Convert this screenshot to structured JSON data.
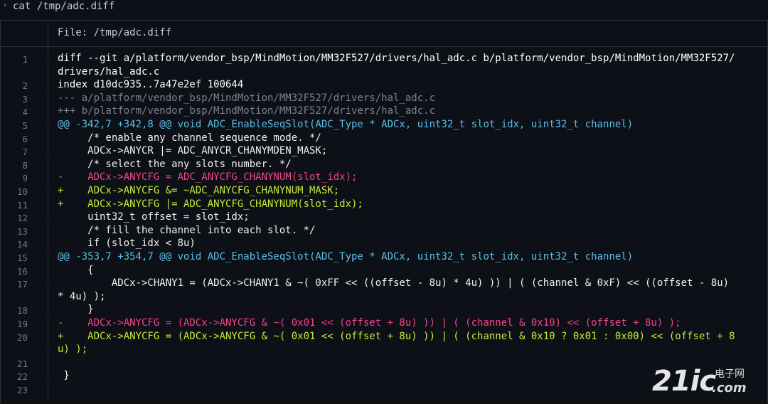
{
  "command": {
    "caret": "›",
    "text": "cat /tmp/adc.diff"
  },
  "file_header": {
    "title": "File: /tmp/adc.diff"
  },
  "lines": [
    {
      "n": "1",
      "text": "diff --git a/platform/vendor_bsp/MindMotion/MM32F527/drivers/hal_adc.c b/platform/vendor_bsp/MindMotion/MM32F527/",
      "kind": "meta"
    },
    {
      "n": "",
      "text": "drivers/hal_adc.c",
      "kind": "meta"
    },
    {
      "n": "2",
      "text": "index d10dc935..7a47e2ef 100644",
      "kind": "meta"
    },
    {
      "n": "3",
      "text": "--- a/platform/vendor_bsp/MindMotion/MM32F527/drivers/hal_adc.c",
      "kind": "hdrminus"
    },
    {
      "n": "4",
      "text": "+++ b/platform/vendor_bsp/MindMotion/MM32F527/drivers/hal_adc.c",
      "kind": "hdrplus"
    },
    {
      "n": "5",
      "text": "@@ -342,7 +342,8 @@ void ADC_EnableSeqSlot(ADC_Type * ADCx, uint32_t slot_idx, uint32_t channel)",
      "kind": "hunk"
    },
    {
      "n": "6",
      "text": "     /* enable any channel sequence mode. */",
      "kind": "ctx"
    },
    {
      "n": "7",
      "text": "     ADCx->ANYCR |= ADC_ANYCR_CHANYMDEN_MASK;",
      "kind": "ctx"
    },
    {
      "n": "8",
      "text": "     /* select the any slots number. */",
      "kind": "ctx"
    },
    {
      "n": "9",
      "text": "-    ADCx->ANYCFG = ADC_ANYCFG_CHANYNUM(slot_idx);",
      "kind": "del"
    },
    {
      "n": "10",
      "text": "+    ADCx->ANYCFG &= ~ADC_ANYCFG_CHANYNUM_MASK;",
      "kind": "add"
    },
    {
      "n": "11",
      "text": "+    ADCx->ANYCFG |= ADC_ANYCFG_CHANYNUM(slot_idx);",
      "kind": "add"
    },
    {
      "n": "12",
      "text": "     uint32_t offset = slot_idx;",
      "kind": "ctx"
    },
    {
      "n": "13",
      "text": "     /* fill the channel into each slot. */",
      "kind": "ctx"
    },
    {
      "n": "14",
      "text": "     if (slot_idx < 8u)",
      "kind": "ctx"
    },
    {
      "n": "15",
      "text": "@@ -353,7 +354,7 @@ void ADC_EnableSeqSlot(ADC_Type * ADCx, uint32_t slot_idx, uint32_t channel)",
      "kind": "hunk"
    },
    {
      "n": "16",
      "text": "     {",
      "kind": "ctx"
    },
    {
      "n": "17",
      "text": "         ADCx->CHANY1 = (ADCx->CHANY1 & ~( 0xFF << ((offset - 8u) * 4u) )) | ( (channel & 0xF) << ((offset - 8u)",
      "kind": "ctx"
    },
    {
      "n": "",
      "text": "* 4u) );",
      "kind": "ctx"
    },
    {
      "n": "18",
      "text": "     }",
      "kind": "ctx"
    },
    {
      "n": "19",
      "text": "-    ADCx->ANYCFG = (ADCx->ANYCFG & ~( 0x01 << (offset + 8u) )) | ( (channel & 0x10) << (offset + 8u) );",
      "kind": "del"
    },
    {
      "n": "20",
      "text": "+    ADCx->ANYCFG = (ADCx->ANYCFG & ~( 0x01 << (offset + 8u) )) | ( (channel & 0x10 ? 0x01 : 0x00) << (offset + 8",
      "kind": "add"
    },
    {
      "n": "",
      "text": "u) );",
      "kind": "add"
    },
    {
      "n": "21",
      "text": "",
      "kind": "ctx"
    },
    {
      "n": "22",
      "text": " }",
      "kind": "ctx"
    },
    {
      "n": "23",
      "text": "",
      "kind": "ctx"
    }
  ],
  "watermark": {
    "big": "21ic",
    "cn": "电子网",
    "com": ".com"
  },
  "colors": {
    "background": "#0d1017",
    "hunk": "#5bbfe8",
    "deletion": "#f0448a",
    "addition": "#c6e83a",
    "file_header_line": "#7a8391"
  }
}
